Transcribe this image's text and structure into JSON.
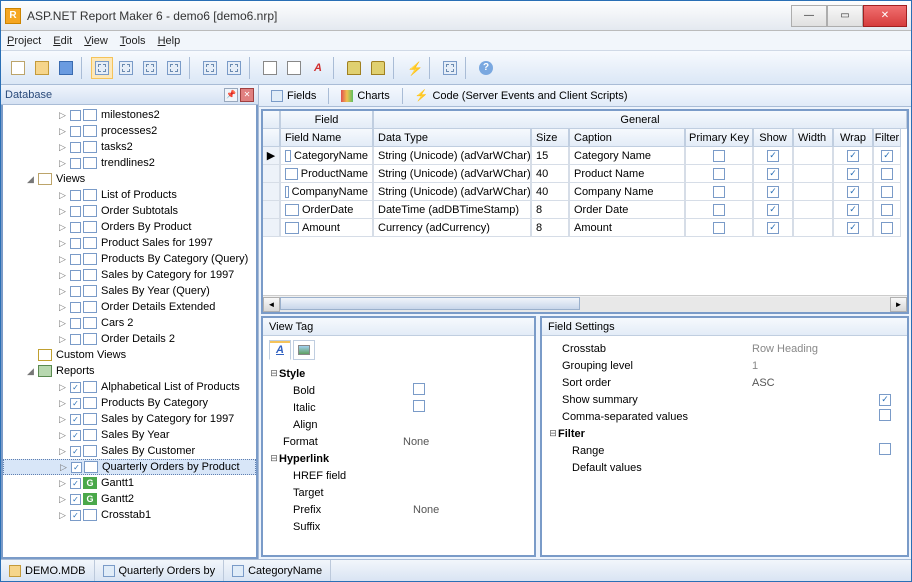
{
  "window": {
    "title": "ASP.NET Report Maker 6 - demo6 [demo6.nrp]"
  },
  "menu": [
    "Project",
    "Edit",
    "View",
    "Tools",
    "Help"
  ],
  "database_panel": {
    "title": "Database"
  },
  "tree": {
    "tables": [
      {
        "label": "milestones2",
        "checked": false
      },
      {
        "label": "processes2",
        "checked": false
      },
      {
        "label": "tasks2",
        "checked": false
      },
      {
        "label": "trendlines2",
        "checked": false
      }
    ],
    "views_label": "Views",
    "views": [
      {
        "label": "List of Products",
        "checked": false
      },
      {
        "label": "Order Subtotals",
        "checked": false
      },
      {
        "label": "Orders By Product",
        "checked": false
      },
      {
        "label": "Product Sales for 1997",
        "checked": false
      },
      {
        "label": "Products By Category (Query)",
        "checked": false
      },
      {
        "label": "Sales by Category for 1997",
        "checked": false
      },
      {
        "label": "Sales By Year (Query)",
        "checked": false
      },
      {
        "label": "Order Details Extended",
        "checked": false
      },
      {
        "label": "Cars 2",
        "checked": false
      },
      {
        "label": "Order Details 2",
        "checked": false
      }
    ],
    "custom_views_label": "Custom Views",
    "reports_label": "Reports",
    "reports": [
      {
        "label": "Alphabetical List of Products",
        "checked": true,
        "icon": "tbl"
      },
      {
        "label": "Products By Category",
        "checked": true,
        "icon": "tbl"
      },
      {
        "label": "Sales by Category for 1997",
        "checked": true,
        "icon": "tbl"
      },
      {
        "label": "Sales By Year",
        "checked": true,
        "icon": "tbl"
      },
      {
        "label": "Sales By Customer",
        "checked": true,
        "icon": "tbl"
      },
      {
        "label": "Quarterly Orders by Product",
        "checked": true,
        "icon": "tbl",
        "selected": true
      },
      {
        "label": "Gantt1",
        "checked": true,
        "icon": "g"
      },
      {
        "label": "Gantt2",
        "checked": true,
        "icon": "g"
      },
      {
        "label": "Crosstab1",
        "checked": true,
        "icon": "tbl"
      }
    ]
  },
  "tabs": {
    "fields": "Fields",
    "charts": "Charts",
    "code": "Code (Server Events and Client Scripts)"
  },
  "grid": {
    "group_field": "Field",
    "group_general": "General",
    "cols": {
      "field_name": "Field Name",
      "data_type": "Data Type",
      "size": "Size",
      "caption": "Caption",
      "primary_key": "Primary Key",
      "show": "Show",
      "width": "Width",
      "wrap": "Wrap",
      "filter": "Filter"
    },
    "rows": [
      {
        "field": "CategoryName",
        "dtype": "String (Unicode) (adVarWChar)",
        "size": "15",
        "caption": "Category Name",
        "pk": false,
        "show": true,
        "wrap": true,
        "filter": true,
        "current": true
      },
      {
        "field": "ProductName",
        "dtype": "String (Unicode) (adVarWChar)",
        "size": "40",
        "caption": "Product Name",
        "pk": false,
        "show": true,
        "wrap": true,
        "filter": false
      },
      {
        "field": "CompanyName",
        "dtype": "String (Unicode) (adVarWChar)",
        "size": "40",
        "caption": "Company Name",
        "pk": false,
        "show": true,
        "wrap": true,
        "filter": false
      },
      {
        "field": "OrderDate",
        "dtype": "DateTime (adDBTimeStamp)",
        "size": "8",
        "caption": "Order Date",
        "pk": false,
        "show": true,
        "wrap": true,
        "filter": false
      },
      {
        "field": "Amount",
        "dtype": "Currency (adCurrency)",
        "size": "8",
        "caption": "Amount",
        "pk": false,
        "show": true,
        "wrap": true,
        "filter": false
      }
    ]
  },
  "view_tag": {
    "title": "View Tag",
    "style_label": "Style",
    "bold": "Bold",
    "italic": "Italic",
    "align": "Align",
    "format": "Format",
    "format_val": "None",
    "hyperlink_label": "Hyperlink",
    "href": "HREF field",
    "target": "Target",
    "prefix": "Prefix",
    "prefix_val": "None",
    "suffix": "Suffix"
  },
  "field_settings": {
    "title": "Field Settings",
    "crosstab": "Crosstab",
    "crosstab_val": "Row Heading",
    "grouping": "Grouping level",
    "grouping_val": "1",
    "sort": "Sort order",
    "sort_val": "ASC",
    "summary": "Show summary",
    "summary_val": true,
    "csv": "Comma-separated values",
    "csv_val": false,
    "filter_label": "Filter",
    "range": "Range",
    "range_val": false,
    "defaults": "Default values"
  },
  "status": {
    "db": "DEMO.MDB",
    "report": "Quarterly Orders by",
    "field": "CategoryName"
  }
}
